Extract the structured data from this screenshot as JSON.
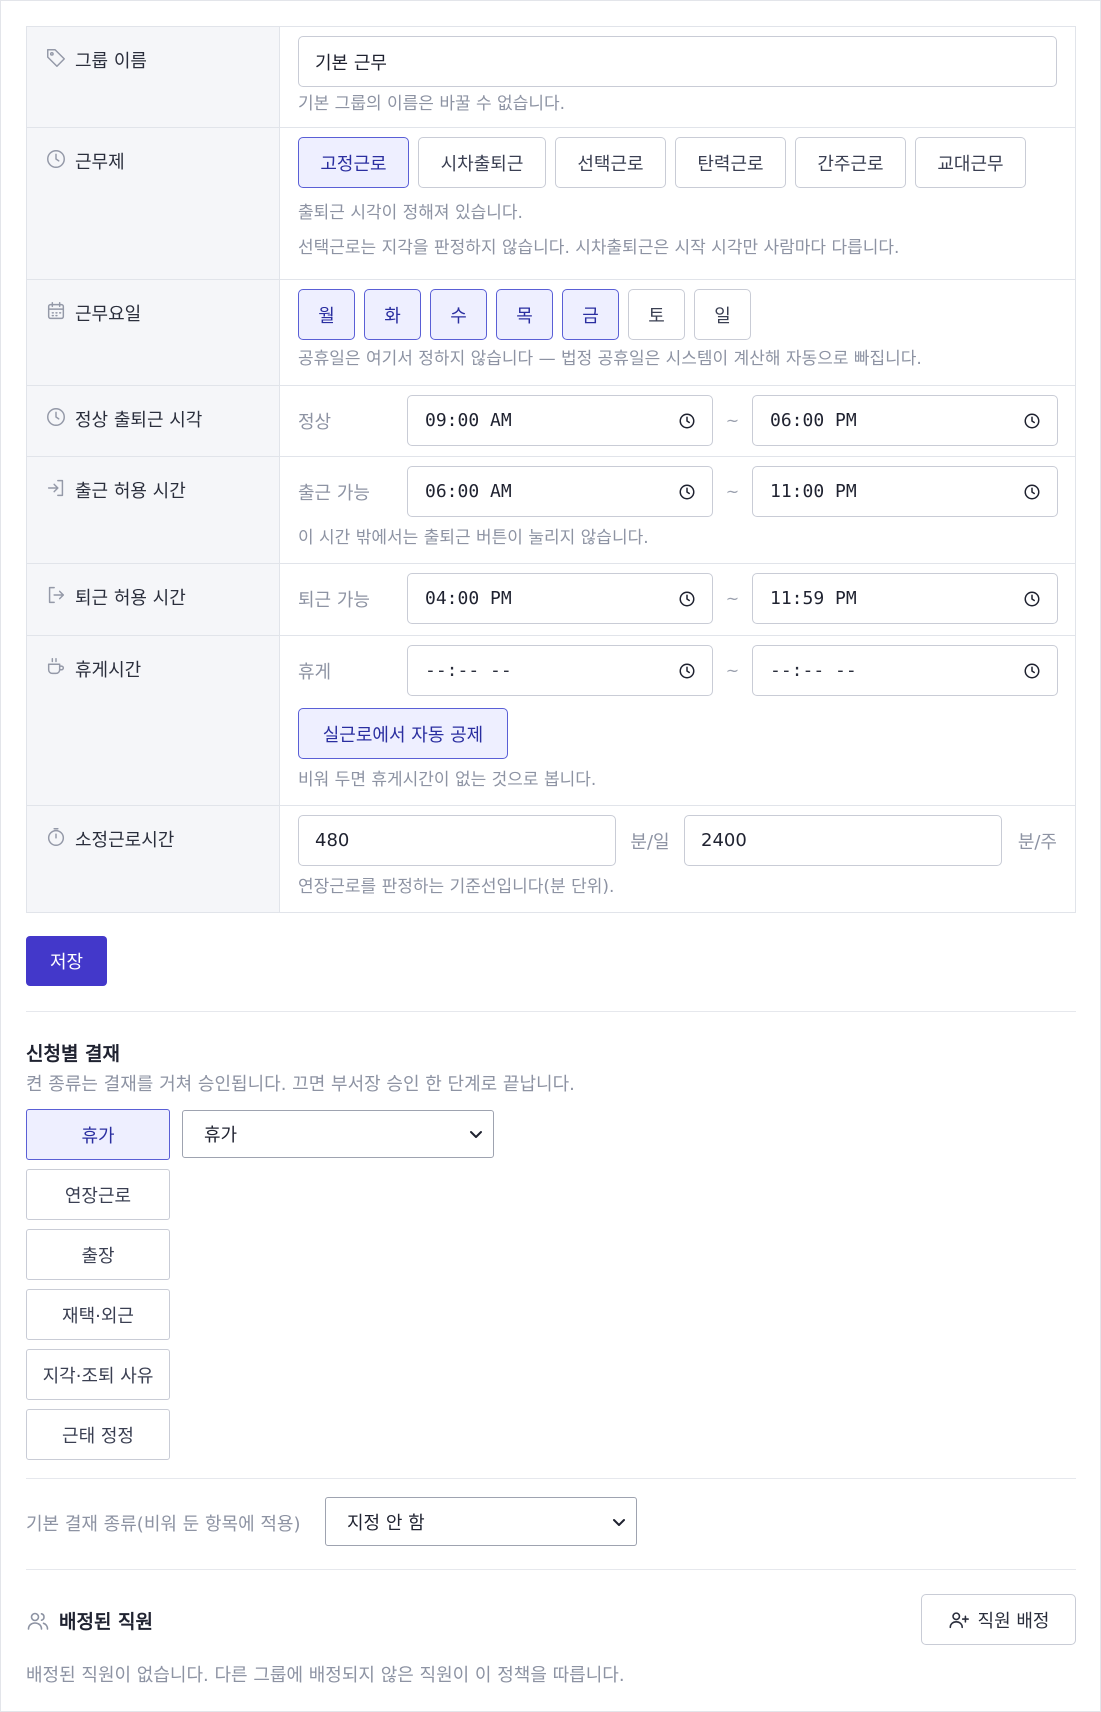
{
  "form": {
    "group_name": {
      "label": "그룹 이름",
      "icon": "tag-icon",
      "value": "기본 근무",
      "help": "기본 그룹의 이름은 바꿀 수 없습니다."
    },
    "work_system": {
      "label": "근무제",
      "icon": "clock-icon",
      "options": [
        "고정근로",
        "시차출퇴근",
        "선택근로",
        "탄력근로",
        "간주근로",
        "교대근무"
      ],
      "selected": "고정근로",
      "help1": "출퇴근 시각이 정해져 있습니다.",
      "help2": "선택근로는 지각을 판정하지 않습니다. 시차출퇴근은 시작 시각만 사람마다 다릅니다."
    },
    "work_days": {
      "label": "근무요일",
      "icon": "calendar-icon",
      "days": [
        "월",
        "화",
        "수",
        "목",
        "금",
        "토",
        "일"
      ],
      "selected": [
        "월",
        "화",
        "수",
        "목",
        "금"
      ],
      "help": "공휴일은 여기서 정하지 않습니다 — 법정 공휴일은 시스템이 계산해 자동으로 빠집니다."
    },
    "normal_time": {
      "label": "정상 출퇴근 시각",
      "icon": "clock-icon",
      "sublabel": "정상",
      "start": "09:00 AM",
      "end": "06:00 PM"
    },
    "checkin_window": {
      "label": "출근 허용 시간",
      "icon": "sign-in-icon",
      "sublabel": "출근 가능",
      "start": "06:00 AM",
      "end": "11:00 PM",
      "help": "이 시간 밖에서는 출퇴근 버튼이 눌리지 않습니다."
    },
    "checkout_window": {
      "label": "퇴근 허용 시간",
      "icon": "sign-out-icon",
      "sublabel": "퇴근 가능",
      "start": "04:00 PM",
      "end": "11:59 PM"
    },
    "break_time": {
      "label": "휴게시간",
      "icon": "coffee-icon",
      "sublabel": "휴게",
      "start": "--:-- --",
      "end": "--:-- --",
      "toggle_label": "실근로에서 자동 공제",
      "help": "비워 두면 휴게시간이 없는 것으로 봅니다."
    },
    "standard_hours": {
      "label": "소정근로시간",
      "icon": "timer-icon",
      "daily_value": "480",
      "daily_unit": "분/일",
      "weekly_value": "2400",
      "weekly_unit": "분/주",
      "help": "연장근로를 판정하는 기준선입니다(분 단위)."
    },
    "tilde": "~"
  },
  "save_label": "저장",
  "approval": {
    "title": "신청별 결재",
    "help": "켠 종류는 결재를 거쳐 승인됩니다. 끄면 부서장 승인 한 단계로 끝납니다.",
    "types": [
      "휴가",
      "연장근로",
      "출장",
      "재택·외근",
      "지각·조퇴 사유",
      "근태 정정"
    ],
    "selected": "휴가",
    "selected_flow": "휴가",
    "default_label": "기본 결재 종류(비워 둔 항목에 적용)",
    "default_value": "지정 안 함"
  },
  "assigned": {
    "title": "배정된 직원",
    "icon": "users-icon",
    "button_label": "직원 배정",
    "button_icon": "user-plus-icon",
    "empty_text": "배정된 직원이 없습니다. 다른 그룹에 배정되지 않은 직원이 이 정책을 따릅니다."
  },
  "colors": {
    "primary": "#4338ca",
    "chip_on_bg": "#eeefff",
    "chip_on_border": "#5a5fd6",
    "help_text": "#8d93a3"
  }
}
